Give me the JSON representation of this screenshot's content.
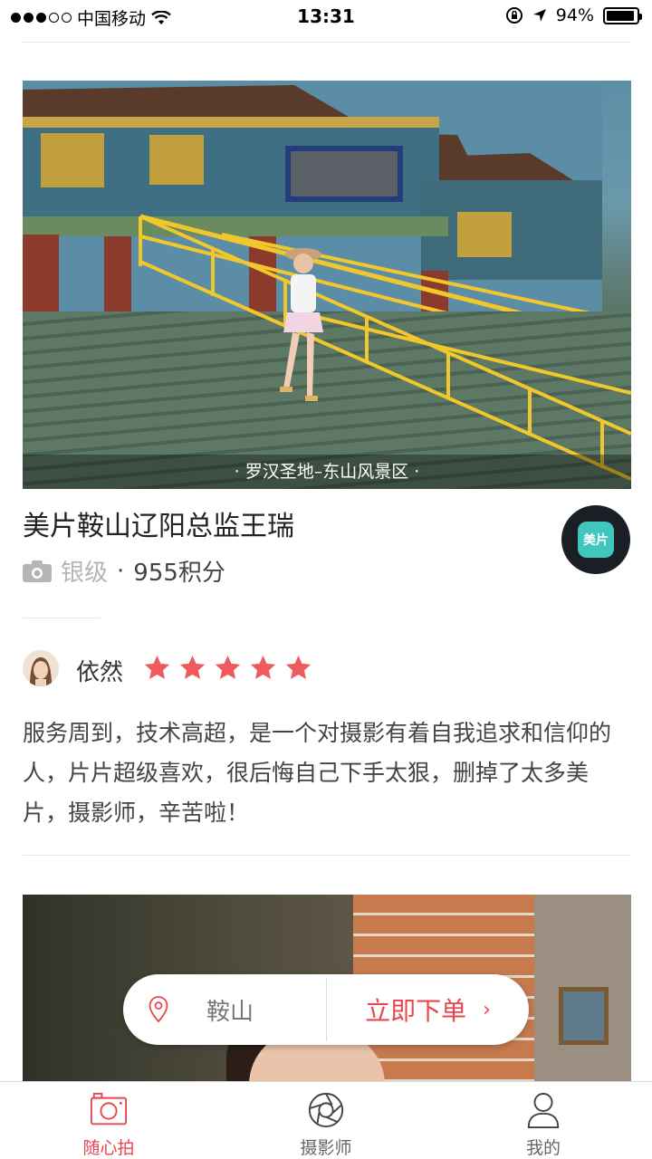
{
  "status_bar": {
    "carrier": "中国移动",
    "time": "13:31",
    "battery_pct": "94%",
    "battery_level": 0.94,
    "signal_bars_on": 3,
    "signal_bars_total": 5
  },
  "card": {
    "photo_location": "· 罗汉圣地–东山风景区 ·",
    "photographer_name": "美片鞍山辽阳总监王瑞",
    "level": "银级",
    "separator": "·",
    "points": "955积分",
    "brand_logo_text": "美片"
  },
  "review": {
    "reviewer_name": "依然",
    "rating": 5,
    "text": "服务周到，技术高超，是一个对摄影有着自我追求和信仰的人，片片超级喜欢，很后悔自己下手太狠，删掉了太多美片，摄影师，辛苦啦！"
  },
  "order_bar": {
    "city": "鞍山",
    "order_label": "立即下单",
    "chevron": "›"
  },
  "nav": {
    "items": [
      {
        "label": "随心拍",
        "icon": "camera-icon",
        "active": true
      },
      {
        "label": "摄影师",
        "icon": "aperture-icon",
        "active": false
      },
      {
        "label": "我的",
        "icon": "user-icon",
        "active": false
      }
    ]
  },
  "colors": {
    "accent": "#e8474f",
    "star": "#ef5a5e",
    "logo_bg": "#3fc6bf"
  }
}
